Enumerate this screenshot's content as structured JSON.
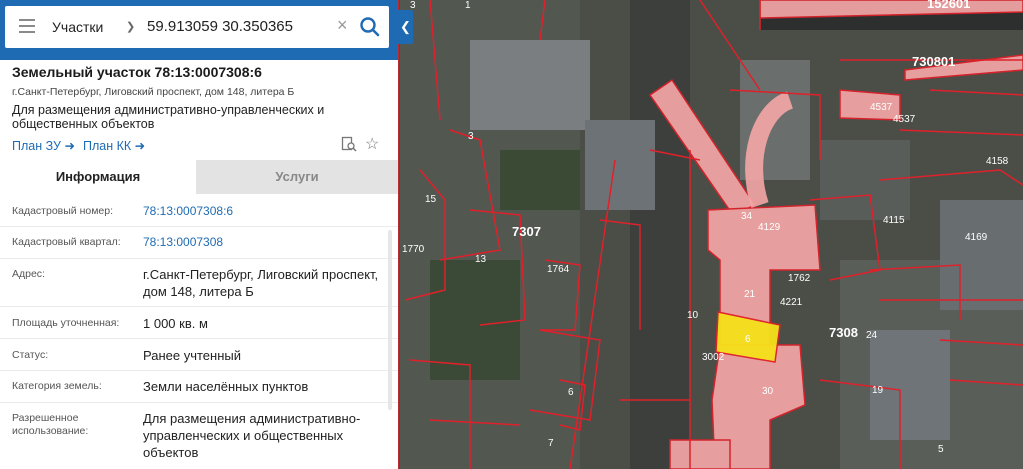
{
  "search": {
    "category": "Участки",
    "query": "59.913059 30.350365"
  },
  "object": {
    "title": "Земельный участок 78:13:0007308:6",
    "address_short": "г.Санкт-Петербург, Лиговский проспект, дом 148, литера Б",
    "purpose_line1": "Для размещения административно-управленческих и",
    "purpose_line2": "общественных объектов",
    "plan_zu": "План ЗУ",
    "plan_kk": "План КК"
  },
  "tabs": {
    "info": "Информация",
    "services": "Услуги"
  },
  "details": [
    {
      "label": "Кадастровый номер:",
      "value": "78:13:0007308:6"
    },
    {
      "label": "Кадастровый квартал:",
      "value": "78:13:0007308"
    },
    {
      "label": "Адрес:",
      "value1": "г.Санкт-Петербург, Лиговский проспект,",
      "value2": "дом 148, литера Б"
    },
    {
      "label": "Площадь уточненная:",
      "value": "1 000 кв. м"
    },
    {
      "label": "Статус:",
      "value": "Ранее учтенный"
    },
    {
      "label": "Категория земель:",
      "value": "Земли населённых пунктов"
    },
    {
      "label1": "Разрешенное",
      "label2": "использование:",
      "value1": "Для размещения административно-",
      "value2": "управленческих и общественных",
      "value3": "объектов"
    }
  ],
  "map": {
    "quarter_labels": [
      "7307",
      "7308",
      "730801",
      "152601"
    ],
    "parcel_labels": [
      "6",
      "34",
      "21",
      "30",
      "1762",
      "4129",
      "4221",
      "3002",
      "4115",
      "4158",
      "1764",
      "1770",
      "15",
      "13",
      "3",
      "7",
      "19",
      "24",
      "10",
      "3",
      "6",
      "1",
      "5",
      "4169",
      "4537",
      "4537"
    ],
    "colors": {
      "boundary": "#e0202a",
      "fill_pink": "#f4a6a6",
      "selected": "#f5e11a"
    }
  }
}
